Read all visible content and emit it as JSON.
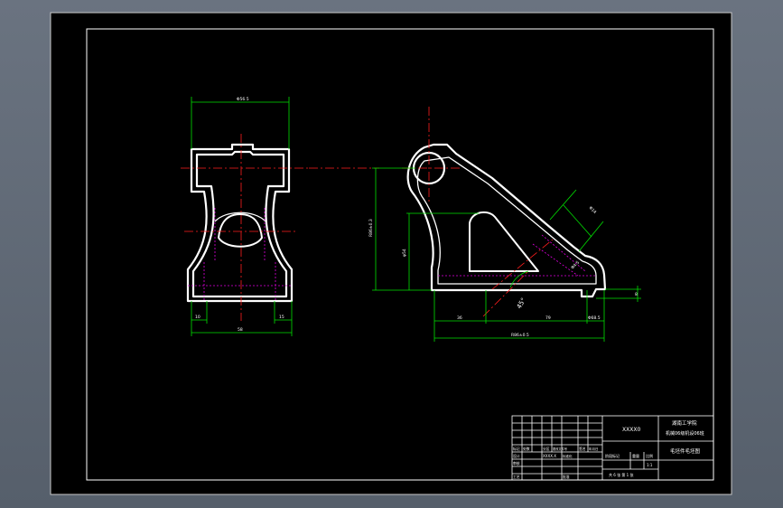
{
  "colors": {
    "background": "#000000",
    "viewport": "#5f6875",
    "outline": "#ffffff",
    "centerline": "#ff1e1e",
    "dimension": "#00e000",
    "hidden": "#e000e0",
    "annotation": "#ffffff"
  },
  "dimensions": {
    "top_width": "Φ56.5",
    "base_left": "10",
    "base_right": "15",
    "base_total": "58",
    "height_total": "R86±0.3",
    "height_inner": "φ54",
    "bottom_left": "36",
    "bottom_mid": "79",
    "bottom_right": "Φ68.5",
    "bottom_total": "R86±0.5",
    "angle": "45°",
    "slot_dim": "Φ14",
    "hole_dim": "Φ4.5",
    "right_vertical": "8"
  },
  "title_block": {
    "drawing_number": "XXXX0",
    "school_line1": "湖南工学院",
    "school_line2": "机械06级机设06班",
    "drawing_title": "毛坯件毛坯图",
    "row_labels": [
      "标记",
      "处数",
      "分区",
      "更改文件号",
      "签名",
      "年月日"
    ],
    "stage_label": "阶段标记",
    "weight_label": "重量",
    "scale_label": "比例",
    "scale_value": "1:1",
    "sheet_label": "共 6 张  第 1 张",
    "design_label": "设计",
    "design_value": "XXXX.X",
    "review_label": "审核",
    "process_label": "工艺",
    "approve_label": "批准",
    "std_label": "标准化"
  }
}
